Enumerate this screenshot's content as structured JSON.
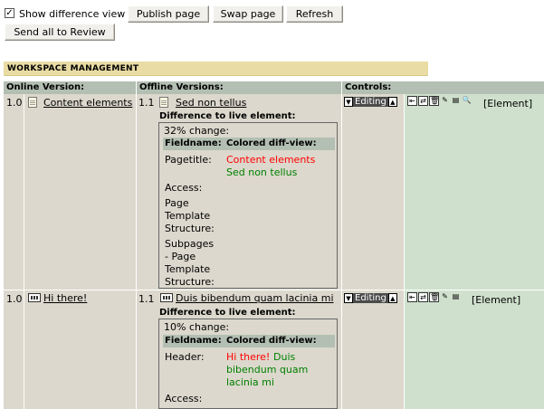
{
  "toolbar": {
    "show_diff_label": "Show difference view",
    "publish_label": "Publish page",
    "swap_label": "Swap page",
    "refresh_label": "Refresh",
    "send_review_label": "Send all to Review"
  },
  "section_title": "WORKSPACE MANAGEMENT",
  "columns": {
    "online": "Online Version:",
    "offline": "Offline Versions:",
    "controls": "Controls:"
  },
  "rows": [
    {
      "online_version": "1.0",
      "online_title": "Content elements",
      "offline_version": "1.1",
      "offline_title": "Sed non tellus",
      "diff_heading": "Difference to live element:",
      "change_pct": "32% change:",
      "fieldname_header": "Fieldname:",
      "diffview_header": "Colored diff-view:",
      "fields": {
        "pagetitle_label": "Pagetitle:",
        "pagetitle_old": "Content elements",
        "pagetitle_new": "Sed non tellus",
        "access_label": "Access:",
        "page_template_label_1": "Page",
        "page_template_label_2": "Template",
        "page_template_label_3": "Structure:",
        "sub_label_1": "Subpages",
        "sub_label_2": "- Page",
        "sub_label_3": "Template",
        "sub_label_4": "Structure:"
      },
      "stage": "Editing",
      "element_label": "[Element]"
    },
    {
      "online_version": "1.0",
      "online_title": "Hi there!",
      "offline_version": "1.1",
      "offline_title": "Duis bibendum quam lacinia mi",
      "diff_heading": "Difference to live element:",
      "change_pct": "10% change:",
      "fieldname_header": "Fieldname:",
      "diffview_header": "Colored diff-view:",
      "fields": {
        "header_label": "Header:",
        "header_old": "Hi there!",
        "header_new_1": "Duis",
        "header_new_2": "bibendum quam",
        "header_new_3": "lacinia mi",
        "access_label": "Access:"
      },
      "stage": "Editing",
      "element_label": "[Element]"
    }
  ],
  "colors": {
    "section_bar": "#e9dca4",
    "header_bg": "#b3bfb3",
    "row_bg": "#dcd8cd",
    "controls_bg": "#cfe1cd",
    "diff_removed": "#ff0000",
    "diff_added": "#008000"
  }
}
